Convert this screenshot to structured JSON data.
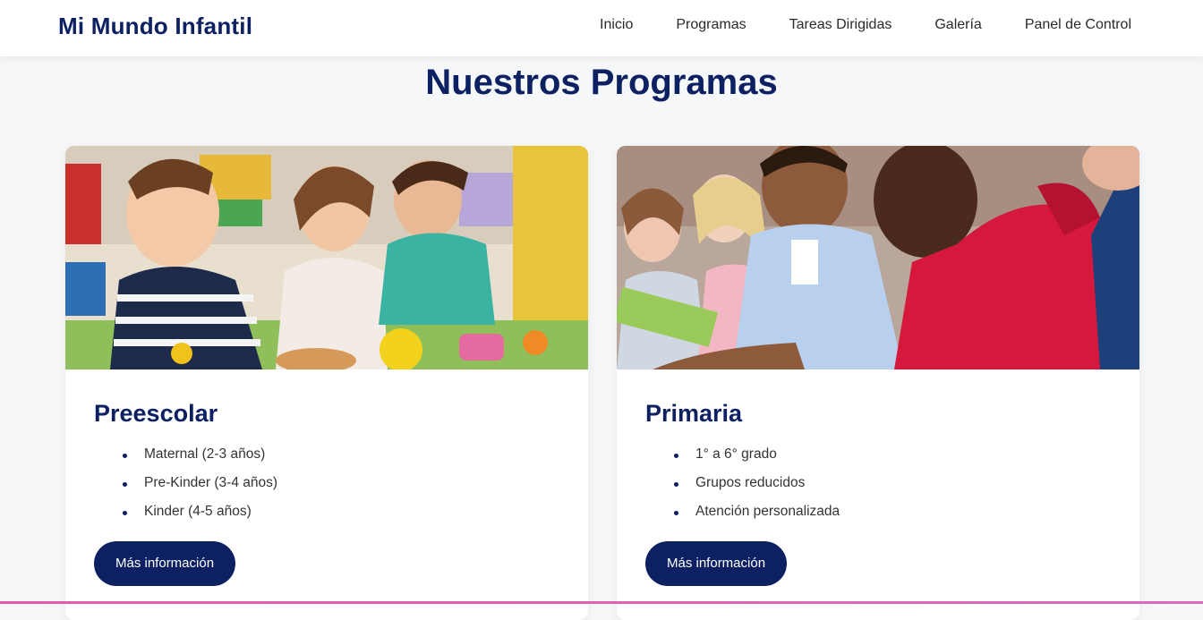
{
  "header": {
    "brand": "Mi Mundo Infantil",
    "nav": [
      "Inicio",
      "Programas",
      "Tareas Dirigidas",
      "Galería",
      "Panel de Control"
    ]
  },
  "main": {
    "title": "Nuestros Programas",
    "cards": [
      {
        "title": "Preescolar",
        "items": [
          "Maternal (2-3 años)",
          "Pre-Kinder (3-4 años)",
          "Kinder (4-5 años)"
        ],
        "button": "Más información"
      },
      {
        "title": "Primaria",
        "items": [
          "1° a 6° grado",
          "Grupos reducidos",
          "Atención personalizada"
        ],
        "button": "Más información"
      }
    ]
  },
  "colors": {
    "brand": "#0d2062",
    "background": "#f6f7f9",
    "accent_line": "#e45aa8"
  }
}
